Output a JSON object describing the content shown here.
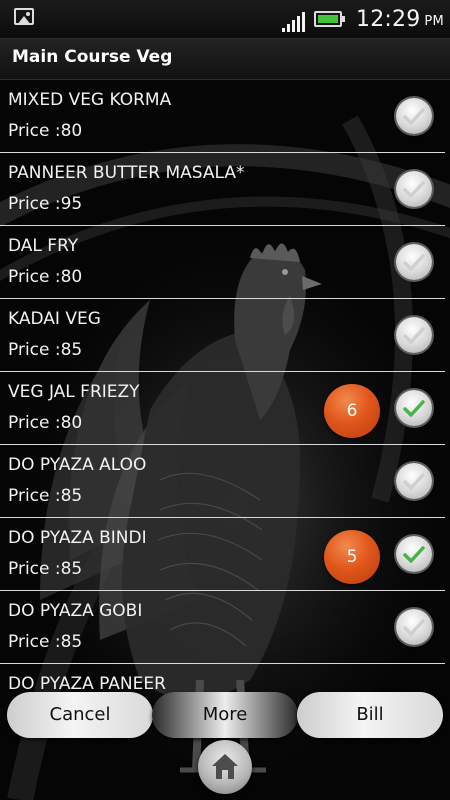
{
  "status_bar": {
    "time": "12:29",
    "ampm": "PM"
  },
  "screen": {
    "title": "Main Course Veg"
  },
  "menu_items": [
    {
      "name": "MIXED VEG KORMA",
      "price": "Price :80",
      "selected": false,
      "quantity": null
    },
    {
      "name": "PANNEER BUTTER MASALA*",
      "price": "Price :95",
      "selected": false,
      "quantity": null
    },
    {
      "name": "DAL FRY",
      "price": "Price :80",
      "selected": false,
      "quantity": null
    },
    {
      "name": "KADAI VEG",
      "price": "Price :85",
      "selected": false,
      "quantity": null
    },
    {
      "name": "VEG JAL FRIEZY",
      "price": "Price :80",
      "selected": true,
      "quantity": "6"
    },
    {
      "name": "DO PYAZA ALOO",
      "price": "Price :85",
      "selected": false,
      "quantity": null
    },
    {
      "name": "DO PYAZA BINDI",
      "price": "Price :85",
      "selected": true,
      "quantity": "5"
    },
    {
      "name": "DO PYAZA GOBI",
      "price": "Price :85",
      "selected": false,
      "quantity": null
    },
    {
      "name": "DO PYAZA PANEER",
      "price": "",
      "selected": false,
      "quantity": null
    }
  ],
  "buttons": {
    "cancel": "Cancel",
    "more": "More",
    "bill": "Bill"
  },
  "colors": {
    "check_selected": "#49b24b",
    "check_unselected": "#cfcfcf",
    "badge": "#e1571c"
  }
}
